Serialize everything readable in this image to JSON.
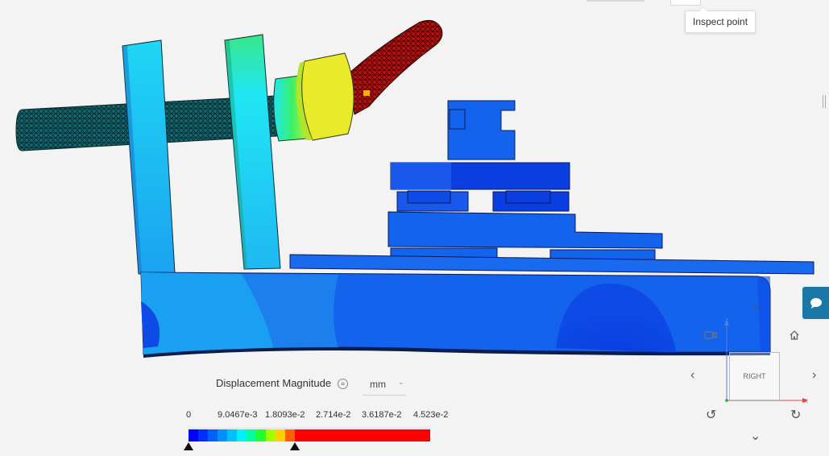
{
  "tooltip": {
    "text": "Inspect point"
  },
  "legend": {
    "title": "Displacement Magnitude",
    "info_glyph": "≡",
    "unit": "mm",
    "ticks": [
      "0",
      "9.0467e-3",
      "1.8093e-2",
      "2.714e-2",
      "3.6187e-2",
      "4.523e-2"
    ],
    "colors": [
      "#0000ff",
      "#0030ff",
      "#0060ff",
      "#0090ff",
      "#00c0ff",
      "#00f0ff",
      "#00ffa0",
      "#20ff30",
      "#a0ff00",
      "#ffd000",
      "#ff6000",
      "#ff0000"
    ],
    "min_marker": 0,
    "max_marker": 0.0181
  },
  "view_cube": {
    "face": "RIGHT",
    "axis_z": "Z",
    "axis_x": "X",
    "axis_y": "Y"
  },
  "icons": {
    "home": "home-icon",
    "camera": "video-camera-icon",
    "chat": "chat-icon",
    "nav_left": "‹",
    "nav_right": "›",
    "nav_up": "⌃",
    "nav_down": "⌄",
    "rotate_left": "↺",
    "rotate_right": "↻"
  },
  "colors": {
    "accent": "#1b78a6",
    "deep_blue": "#0a3ee0",
    "mid_blue": "#1463ec",
    "light_blue": "#1fa6f2",
    "cyan": "#20e6f4",
    "green": "#3af06a",
    "yellow": "#e8ea2a",
    "red": "#ff0000"
  }
}
